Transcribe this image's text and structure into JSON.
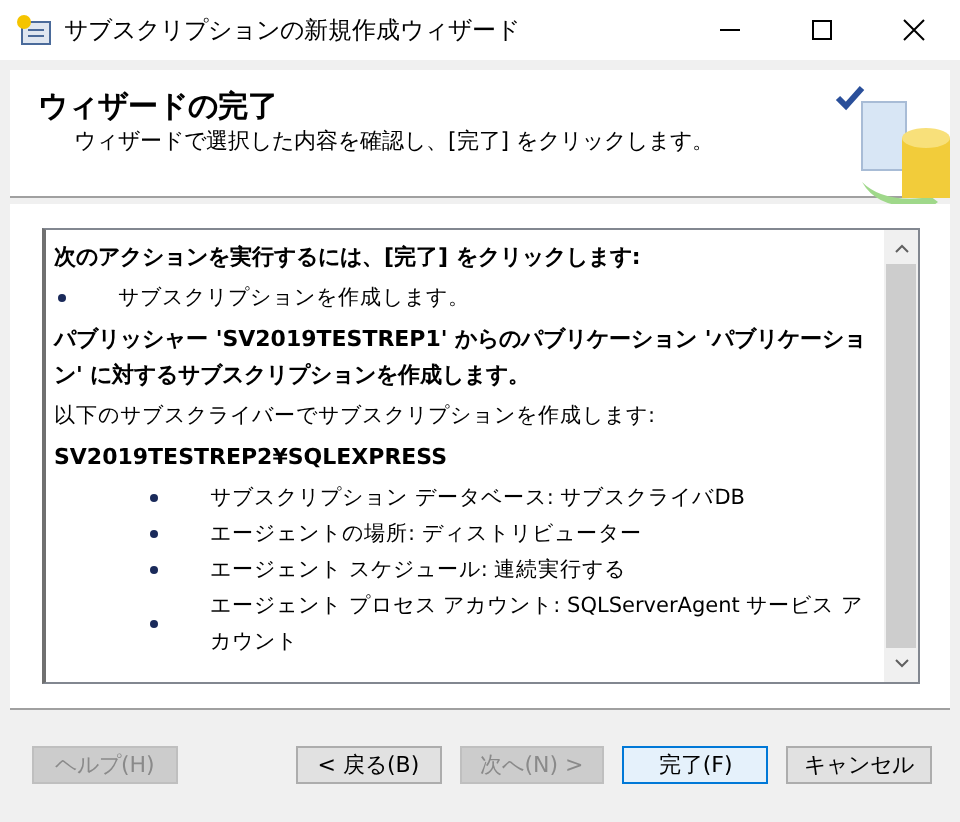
{
  "window": {
    "title": "サブスクリプションの新規作成ウィザード"
  },
  "header": {
    "title": "ウィザードの完了",
    "subtitle": "ウィザードで選択した内容を確認し、[完了] をクリックします。"
  },
  "summary": [
    {
      "kind": "heading",
      "text": "次のアクションを実行するには、[完了] をクリックします:"
    },
    {
      "kind": "bullet",
      "text": "サブスクリプションを作成します。"
    },
    {
      "kind": "heading",
      "text": "パブリッシャー 'SV2019TESTREP1' からのパブリケーション 'パブリケーション' に対するサブスクリプションを作成します。"
    },
    {
      "kind": "text",
      "text": "以下のサブスクライバーでサブスクリプションを作成します:"
    },
    {
      "kind": "heading",
      "text": "SV2019TESTREP2¥SQLEXPRESS"
    },
    {
      "kind": "subbullet",
      "text": "サブスクリプション データベース: サブスクライバDB"
    },
    {
      "kind": "subbullet",
      "text": "エージェントの場所: ディストリビューター"
    },
    {
      "kind": "subbullet",
      "text": "エージェント スケジュール: 連続実行する"
    },
    {
      "kind": "subbullet",
      "text": "エージェント プロセス アカウント: SQLServerAgent サービス アカウント"
    }
  ],
  "buttons": [
    {
      "label": "ヘルプ(H)",
      "disabled": true,
      "default": false
    },
    {
      "label": "< 戻る(B)",
      "disabled": false,
      "default": false
    },
    {
      "label": "次へ(N) >",
      "disabled": true,
      "default": false
    },
    {
      "label": "完了(F)",
      "disabled": false,
      "default": true
    },
    {
      "label": "キャンセル",
      "disabled": false,
      "default": false
    }
  ]
}
